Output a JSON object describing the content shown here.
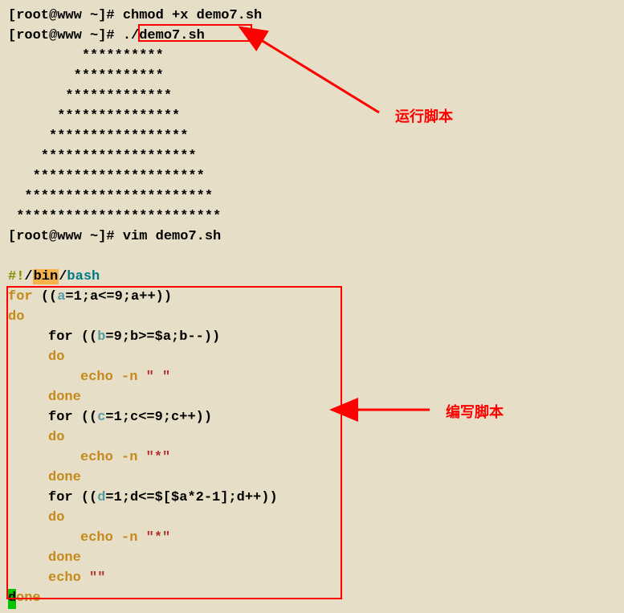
{
  "prompt1": {
    "user": "[root@www ~]# ",
    "cmd": "chmod +x demo7.sh"
  },
  "prompt2": {
    "user": "[root@www ~]# ",
    "cmd": "./demo7.sh"
  },
  "output": {
    "l1": "         **********",
    "l2": "        ***********",
    "l3": "       *************",
    "l4": "      ***************",
    "l5": "     *****************",
    "l6": "    *******************",
    "l7": "   *********************",
    "l8": "  ***********************",
    "l9": " *************************"
  },
  "prompt3": {
    "user": "[root@www ~]# ",
    "cmd": "vim demo7.sh"
  },
  "shebang": {
    "hash": "#!",
    "slash1": "/",
    "bin": "bin",
    "slash2": "/",
    "bash": "bash"
  },
  "code": {
    "for": "for",
    "do": "do",
    "done": "done",
    "echo": "echo",
    "flag_n": "-n",
    "open": "((",
    "close": "))",
    "a": "a",
    "b": "b",
    "c": "c",
    "d": "d",
    "eq1": "=1",
    "eq9": "=9",
    "semi": ";",
    "a_le9": "<=9",
    "b_ge_a": ">=$a",
    "c_le9": "<=9",
    "d_le_expr": "<=$[$a*2-1]",
    "app": "++",
    "bmm": "--",
    "cpp": "++",
    "dpp": "++",
    "str_space": "\" \"",
    "str_star": "\"*\"",
    "str_empty": "\"\""
  },
  "cursor_char": "d",
  "done_rest": "one",
  "annotation1": "运行脚本",
  "annotation2": "编写脚本"
}
